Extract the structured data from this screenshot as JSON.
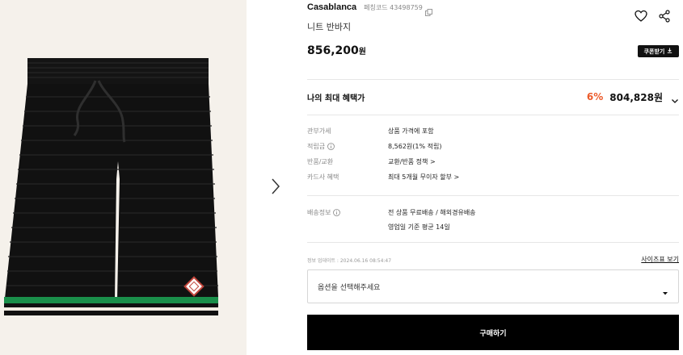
{
  "product": {
    "brand": "Casablanca",
    "code_label": "페칭코드 43498759",
    "name": "니트 반바지",
    "price": "856,200",
    "price_unit": "원"
  },
  "actions": {
    "coupon_label": "쿠폰받기",
    "buy_label": "구매하기",
    "size_chart_label": "사이즈표 보기"
  },
  "benefit": {
    "label": "나의 최대 혜택가",
    "discount": "6%",
    "price": "804,828원"
  },
  "details": [
    {
      "label": "관부가세",
      "value": "상품 가격에 포함"
    },
    {
      "label": "적립금",
      "value": "8,562원(1% 적립)"
    },
    {
      "label": "반품/교환",
      "value": "교환/반품 정책 >"
    },
    {
      "label": "카드사 혜택",
      "value": "최대 5개월 무이자 할부 >"
    }
  ],
  "shipping": {
    "label": "배송정보",
    "line1": "전 상품 무료배송 / 해외경유배송",
    "line2": "영업일 기준 평균 14일"
  },
  "update_info": "정보 업데이트 : 2024.06.16 08:54:47",
  "option": {
    "placeholder": "옵션을 선택해주세요"
  },
  "colors": {
    "accent_discount": "#ec5a2a",
    "product_bg": "#f5f1eb",
    "stripe_green": "#1a8f4a",
    "button_black": "#000000"
  },
  "icons": [
    "copy-icon",
    "heart-icon",
    "share-icon",
    "download-icon",
    "chevron-down-icon",
    "info-icon",
    "caret-down-icon",
    "chevron-right-icon"
  ]
}
